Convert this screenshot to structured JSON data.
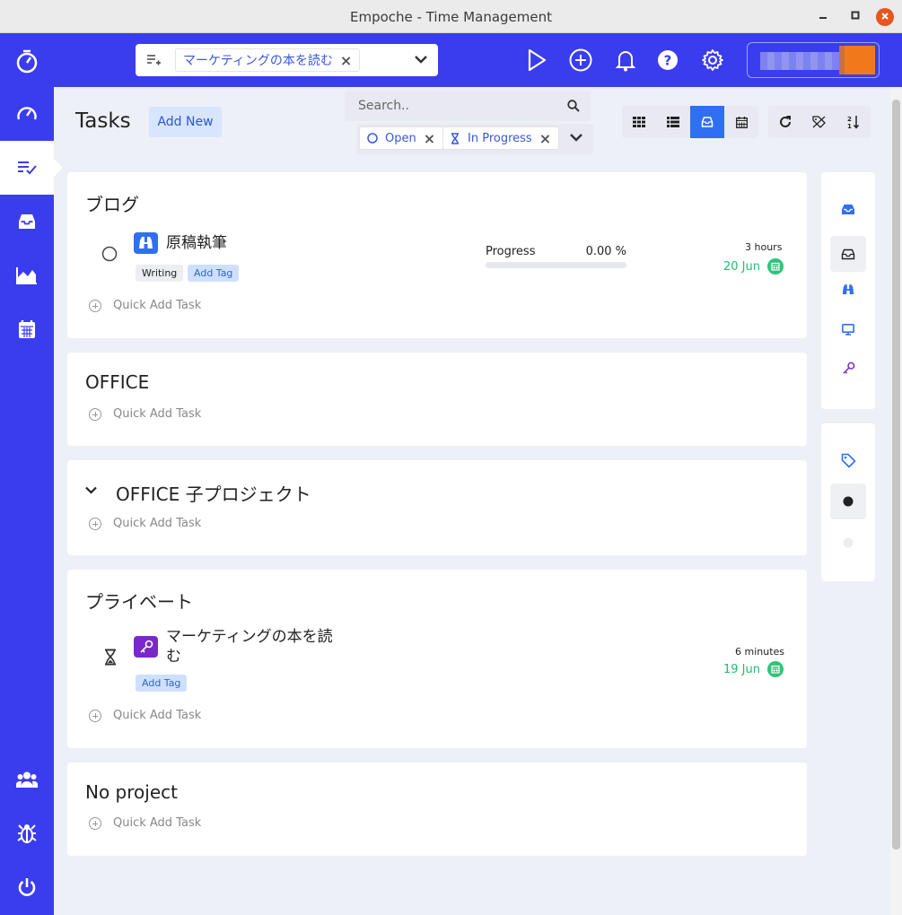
{
  "window": {
    "title": "Empoche - Time Management"
  },
  "appbar": {
    "selected_task": "マーケティングの本を読む",
    "icons": [
      "play-icon",
      "plus-circle-icon",
      "bell-icon",
      "help-icon",
      "gear-icon"
    ]
  },
  "sidebar": {
    "items": [
      {
        "icon": "dashboard-icon",
        "active": false
      },
      {
        "icon": "tasks-icon",
        "active": true
      },
      {
        "icon": "inbox-icon",
        "active": false
      },
      {
        "icon": "chart-icon",
        "active": false
      },
      {
        "icon": "calendar-icon",
        "active": false
      }
    ],
    "bottom": [
      {
        "icon": "team-icon"
      },
      {
        "icon": "bug-icon"
      },
      {
        "icon": "power-icon"
      }
    ]
  },
  "main": {
    "title": "Tasks",
    "add_new": "Add New",
    "search_placeholder": "Search..",
    "filters": [
      {
        "label": "Open",
        "icon": "circle-icon"
      },
      {
        "label": "In Progress",
        "icon": "hourglass-icon"
      }
    ]
  },
  "projects": [
    {
      "name": "ブログ",
      "tasks": [
        {
          "name": "原稿執筆",
          "tags": [
            "Writing"
          ],
          "add_tag": "Add Tag",
          "progress_label": "Progress",
          "progress": "0.00 %",
          "progress_fraction": 0,
          "duration": "3 hours",
          "due": "20 Jun"
        }
      ],
      "quick_add": "Quick Add Task"
    },
    {
      "name": "OFFICE",
      "quick_add": "Quick Add Task"
    },
    {
      "name": "OFFICE 子プロジェクト",
      "quick_add": "Quick Add Task"
    },
    {
      "name": "プライベート",
      "tasks": [
        {
          "name_line1": "マーケティングの本を読",
          "name_line2": "む",
          "add_tag": "Add Tag",
          "duration": "6 minutes",
          "due": "19 Jun"
        }
      ],
      "quick_add": "Quick Add Task"
    },
    {
      "name": "No project",
      "quick_add": "Quick Add Task"
    }
  ],
  "colors": {
    "accent": "#3a3ded",
    "primary_blue": "#2f6ff2",
    "due_green": "#28b870"
  }
}
